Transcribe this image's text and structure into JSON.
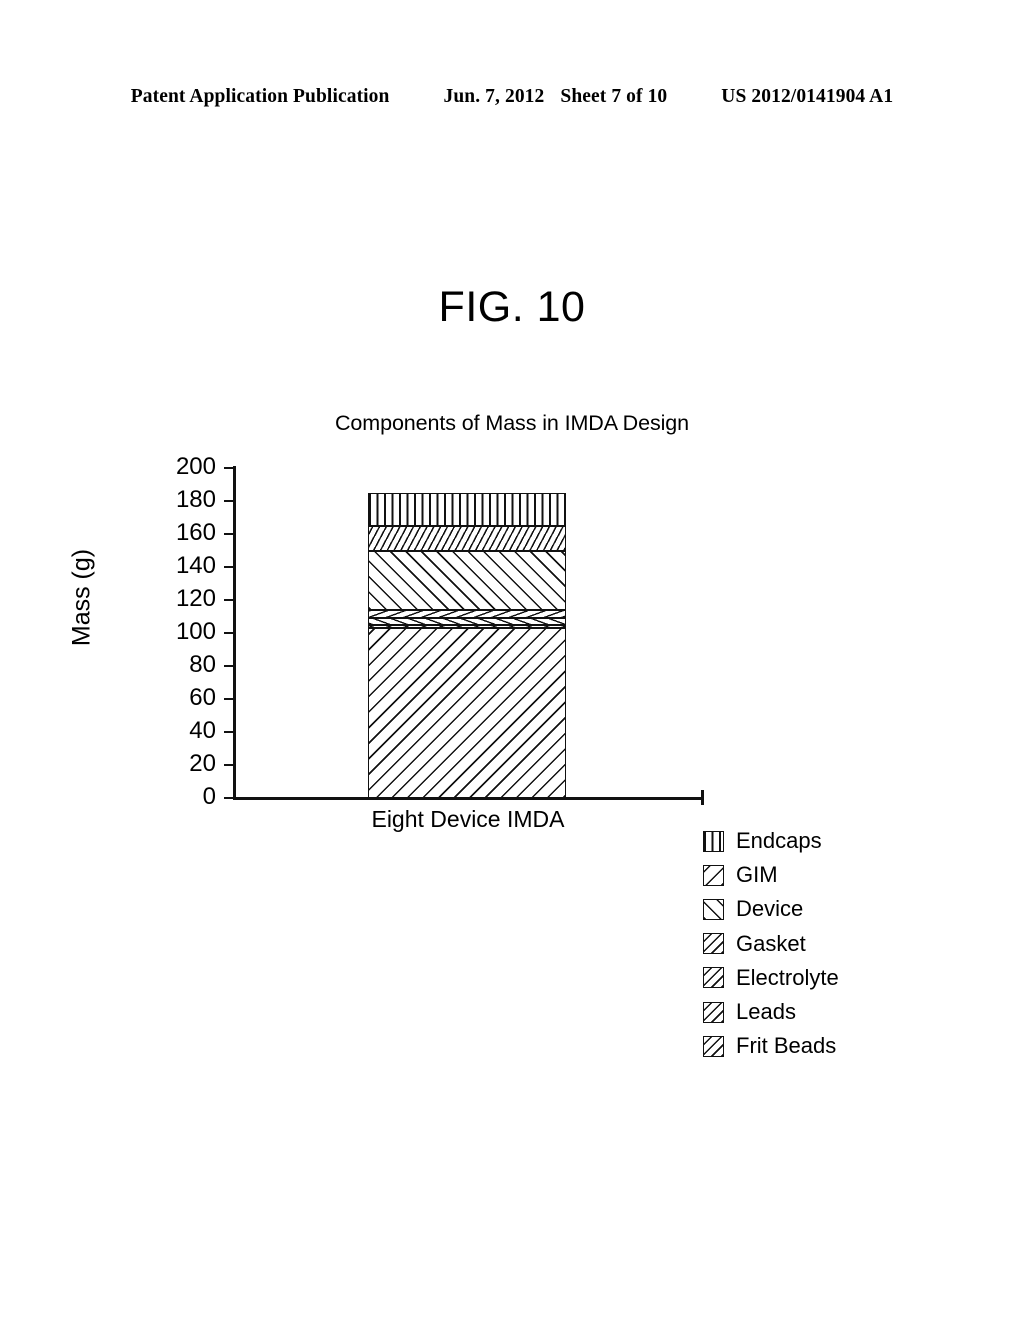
{
  "header": {
    "publication": "Patent Application Publication",
    "date": "Jun. 7, 2012",
    "sheet": "Sheet 7 of 10",
    "number": "US 2012/0141904 A1"
  },
  "figure": {
    "label": "FIG. 10"
  },
  "chart_data": {
    "type": "bar",
    "stacked": true,
    "title": "Components of Mass in IMDA Design",
    "xlabel": "",
    "ylabel": "Mass (g)",
    "categories": [
      "Eight Device IMDA"
    ],
    "ylim": [
      0,
      200
    ],
    "yticks": [
      0,
      20,
      40,
      60,
      80,
      100,
      120,
      140,
      160,
      180,
      200
    ],
    "ytick_labels": [
      "0",
      "20",
      "40",
      "60",
      "80",
      "100",
      "120",
      "140",
      "160",
      "180",
      "200"
    ],
    "grid": false,
    "legend_position": "right-below",
    "total": 185,
    "series": [
      {
        "name": "Endcaps",
        "values": [
          20
        ],
        "cumulative_top": 185,
        "cumulative_bottom": 165,
        "pattern": "vertical-lines"
      },
      {
        "name": "GIM",
        "values": [
          15
        ],
        "cumulative_top": 165,
        "cumulative_bottom": 150,
        "pattern": "backslash-hatch-dense"
      },
      {
        "name": "Device",
        "values": [
          36
        ],
        "cumulative_top": 150,
        "cumulative_bottom": 114,
        "pattern": "forward-slash-hatch-wide"
      },
      {
        "name": "Gasket",
        "values": [
          5
        ],
        "cumulative_top": 114,
        "cumulative_bottom": 109,
        "pattern": "backslash-hatch-flat"
      },
      {
        "name": "Electrolyte",
        "values": [
          4
        ],
        "cumulative_top": 109,
        "cumulative_bottom": 105,
        "pattern": "forward-slash-hatch-flat"
      },
      {
        "name": "Leads",
        "values": [
          2
        ],
        "cumulative_top": 105,
        "cumulative_bottom": 103,
        "pattern": "backslash-hatch-flat"
      },
      {
        "name": "Frit Beads",
        "values": [
          103
        ],
        "cumulative_top": 103,
        "cumulative_bottom": 0,
        "pattern": "backslash-hatch-wide"
      }
    ],
    "legend": [
      {
        "label": "Endcaps",
        "swatch": "vertical-lines"
      },
      {
        "label": "GIM",
        "swatch": "backslash-hatch-wide"
      },
      {
        "label": "Device",
        "swatch": "forward-slash-hatch-wide"
      },
      {
        "label": "Gasket",
        "swatch": "backslash-hatch-mid"
      },
      {
        "label": "Electrolyte",
        "swatch": "backslash-hatch-mid"
      },
      {
        "label": "Leads",
        "swatch": "backslash-hatch-mid"
      },
      {
        "label": "Frit Beads",
        "swatch": "backslash-hatch-mid"
      }
    ]
  }
}
